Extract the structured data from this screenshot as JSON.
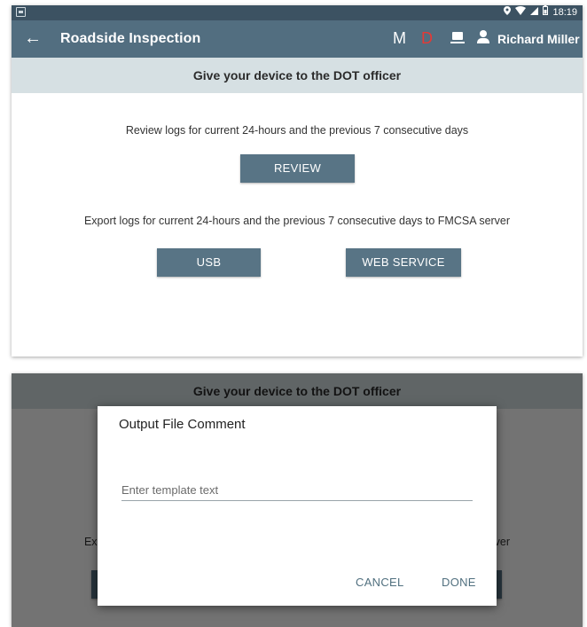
{
  "status_bar": {
    "time": "18:19",
    "icons": [
      "location-icon",
      "wifi-icon",
      "signal-icon",
      "battery-icon"
    ]
  },
  "app_bar": {
    "title": "Roadside Inspection",
    "mode_m": "M",
    "mode_d": "D",
    "user_name": "Richard Miller"
  },
  "banner": "Give your device to the DOT officer",
  "review_section": {
    "text": "Review logs for current 24-hours and the previous 7 consecutive days",
    "button": "REVIEW"
  },
  "export_section": {
    "text": "Export logs for current 24-hours and the previous 7 consecutive days to FMCSA server",
    "usb_button": "USB",
    "web_service_button": "WEB SERVICE"
  },
  "dialog": {
    "title": "Output File Comment",
    "input_placeholder": "Enter template text",
    "input_value": "",
    "cancel": "CANCEL",
    "done": "DONE"
  },
  "colors": {
    "status_bar": "#3c5262",
    "app_bar": "#526e80",
    "banner": "#d6e0e3",
    "button": "#587485",
    "mode_d": "#e53935",
    "dialog_action": "#51707f"
  }
}
